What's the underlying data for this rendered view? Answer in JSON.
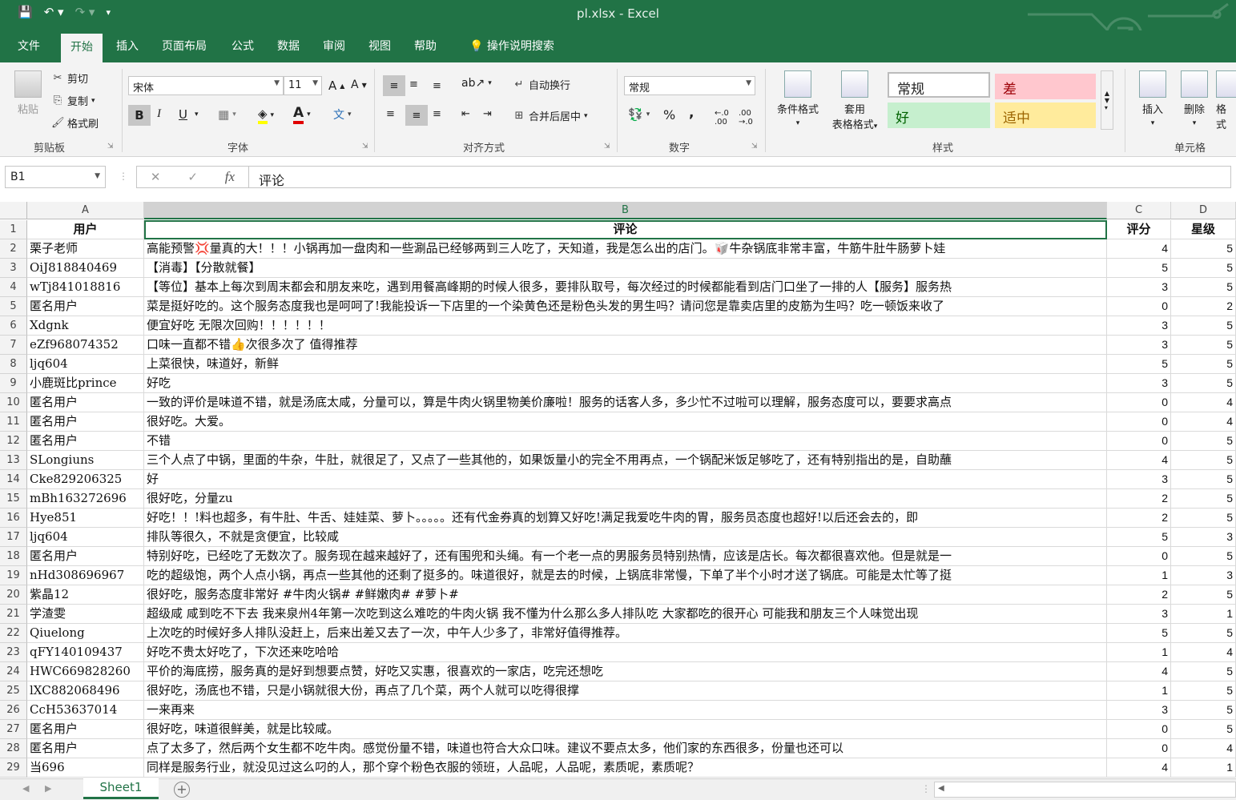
{
  "window": {
    "title": "pl.xlsx  -  Excel"
  },
  "tabs": [
    "文件",
    "开始",
    "插入",
    "页面布局",
    "公式",
    "数据",
    "审阅",
    "视图",
    "帮助",
    "操作说明搜索"
  ],
  "ribbon": {
    "paste": "粘贴",
    "cut": "剪切",
    "copy": "复制",
    "format_painter": "格式刷",
    "clipboard_label": "剪贴板",
    "font_name": "宋体",
    "font_size": "11",
    "font_label": "字体",
    "bold": "B",
    "italic": "I",
    "underline": "U",
    "wrap_text": "自动换行",
    "merge_center": "合并后居中",
    "align_label": "对齐方式",
    "number_format": "常规",
    "number_label": "数字",
    "percent": "%",
    "comma": ",",
    "cond_format": "条件格式",
    "table_format_1": "套用",
    "table_format_2": "表格格式",
    "style_normal": "常规",
    "style_bad": "差",
    "style_good": "好",
    "style_neutral": "适中",
    "styles_label": "样式",
    "insert": "插入",
    "delete": "删除",
    "format": "格式",
    "cells_label": "单元格"
  },
  "formula_bar": {
    "name_box": "B1",
    "fx": "fx",
    "content": "评论"
  },
  "columns": [
    "A",
    "B",
    "C",
    "D"
  ],
  "rows": [
    {
      "n": "1",
      "a": "用户",
      "b": "评论",
      "c": "评分",
      "d": "星级"
    },
    {
      "n": "2",
      "a": "栗子老师",
      "b": "高能预警💢量真的大！！！小锅再加一盘肉和一些涮品已经够两到三人吃了，天知道，我是怎么出的店门。🥡牛杂锅底非常丰富，牛筋牛肚牛肠萝卜娃",
      "c": "4",
      "d": "5"
    },
    {
      "n": "3",
      "a": "OiJ818840469",
      "b": "【消毒】【分散就餐】",
      "c": "5",
      "d": "5"
    },
    {
      "n": "4",
      "a": "wTj841018816",
      "b": "【等位】基本上每次到周末都会和朋友来吃，遇到用餐高峰期的时候人很多，要排队取号，每次经过的时候都能看到店门口坐了一排的人【服务】服务热",
      "c": "3",
      "d": "5"
    },
    {
      "n": "5",
      "a": "匿名用户",
      "b": "菜是挺好吃的。这个服务态度我也是呵呵了!我能投诉一下店里的一个染黄色还是粉色头发的男生吗？请问您是靠卖店里的皮筋为生吗？吃一顿饭来收了",
      "c": "0",
      "d": "2"
    },
    {
      "n": "6",
      "a": "Xdgnk",
      "b": "便宜好吃 无限次回购！！！！！！",
      "c": "3",
      "d": "5"
    },
    {
      "n": "7",
      "a": "eZf968074352",
      "b": "口味一直都不错👍次很多次了 值得推荐",
      "c": "3",
      "d": "5"
    },
    {
      "n": "8",
      "a": "ljq604",
      "b": "上菜很快，味道好，新鲜",
      "c": "5",
      "d": "5"
    },
    {
      "n": "9",
      "a": "小鹿斑比prince",
      "b": "好吃",
      "c": "3",
      "d": "5"
    },
    {
      "n": "10",
      "a": "匿名用户",
      "b": "一致的评价是味道不错，就是汤底太咸，分量可以，算是牛肉火锅里物美价廉啦！服务的话客人多，多少忙不过啦可以理解，服务态度可以，要要求高点",
      "c": "0",
      "d": "4"
    },
    {
      "n": "11",
      "a": "匿名用户",
      "b": "很好吃。大爱。",
      "c": "0",
      "d": "4"
    },
    {
      "n": "12",
      "a": "匿名用户",
      "b": "不错",
      "c": "0",
      "d": "5"
    },
    {
      "n": "13",
      "a": "SLongiuns",
      "b": "三个人点了中锅，里面的牛杂，牛肚，就很足了，又点了一些其他的，如果饭量小的完全不用再点，一个锅配米饭足够吃了，还有特别指出的是，自助蘸",
      "c": "4",
      "d": "5"
    },
    {
      "n": "14",
      "a": "Cke829206325",
      "b": "好",
      "c": "3",
      "d": "5"
    },
    {
      "n": "15",
      "a": "mBh163272696",
      "b": "很好吃，分量zu",
      "c": "2",
      "d": "5"
    },
    {
      "n": "16",
      "a": "Hye851",
      "b": "好吃！！!料也超多，有牛肚、牛舌、娃娃菜、萝卜。。。。。还有代金券真的划算又好吃!满足我爱吃牛肉的胃，服务员态度也超好!以后还会去的，即",
      "c": "2",
      "d": "5"
    },
    {
      "n": "17",
      "a": "ljq604",
      "b": "排队等很久，不就是贪便宜，比较咸",
      "c": "5",
      "d": "3"
    },
    {
      "n": "18",
      "a": "匿名用户",
      "b": "特别好吃，已经吃了无数次了。服务现在越来越好了，还有围兜和头绳。有一个老一点的男服务员特别热情，应该是店长。每次都很喜欢他。但是就是一",
      "c": "0",
      "d": "5"
    },
    {
      "n": "19",
      "a": "nHd308696967",
      "b": "吃的超级饱，两个人点小锅，再点一些其他的还剩了挺多的。味道很好，就是去的时候，上锅底非常慢，下单了半个小时才送了锅底。可能是太忙等了挺",
      "c": "1",
      "d": "3"
    },
    {
      "n": "20",
      "a": "紫晶12",
      "b": "很好吃，服务态度非常好 #牛肉火锅# #鲜嫩肉# #萝卜#",
      "c": "2",
      "d": "5"
    },
    {
      "n": "21",
      "a": "学渣雯",
      "b": "超级咸 咸到吃不下去 我来泉州4年第一次吃到这么难吃的牛肉火锅   我不懂为什么那么多人排队吃 大家都吃的很开心  可能我和朋友三个人味觉出现",
      "c": "3",
      "d": "1"
    },
    {
      "n": "22",
      "a": "Qiuelong",
      "b": "上次吃的时候好多人排队没赶上，后来出差又去了一次，中午人少多了，非常好值得推荐。",
      "c": "5",
      "d": "5"
    },
    {
      "n": "23",
      "a": "qFY140109437",
      "b": "好吃不贵太好吃了，下次还来吃哈哈",
      "c": "1",
      "d": "4"
    },
    {
      "n": "24",
      "a": "HWC669828260",
      "b": "平价的海底捞，服务真的是好到想要点赞，好吃又实惠，很喜欢的一家店，吃完还想吃",
      "c": "4",
      "d": "5"
    },
    {
      "n": "25",
      "a": "lXC882068496",
      "b": "很好吃，汤底也不错，只是小锅就很大份，再点了几个菜，两个人就可以吃得很撑",
      "c": "1",
      "d": "5"
    },
    {
      "n": "26",
      "a": "CcH53637014",
      "b": "一来再来",
      "c": "3",
      "d": "5"
    },
    {
      "n": "27",
      "a": "匿名用户",
      "b": "很好吃，味道很鲜美，就是比较咸。",
      "c": "0",
      "d": "5"
    },
    {
      "n": "28",
      "a": "匿名用户",
      "b": "点了太多了，然后两个女生都不吃牛肉。感觉份量不错，味道也符合大众口味。建议不要点太多，他们家的东西很多，份量也还可以",
      "c": "0",
      "d": "4"
    },
    {
      "n": "29",
      "a": "当696",
      "b": "同样是服务行业，就没见过这么叼的人，那个穿个粉色衣服的领班，人品呢，人品呢，素质呢，素质呢？",
      "c": "4",
      "d": "1"
    }
  ],
  "sheet": {
    "tab": "Sheet1"
  }
}
